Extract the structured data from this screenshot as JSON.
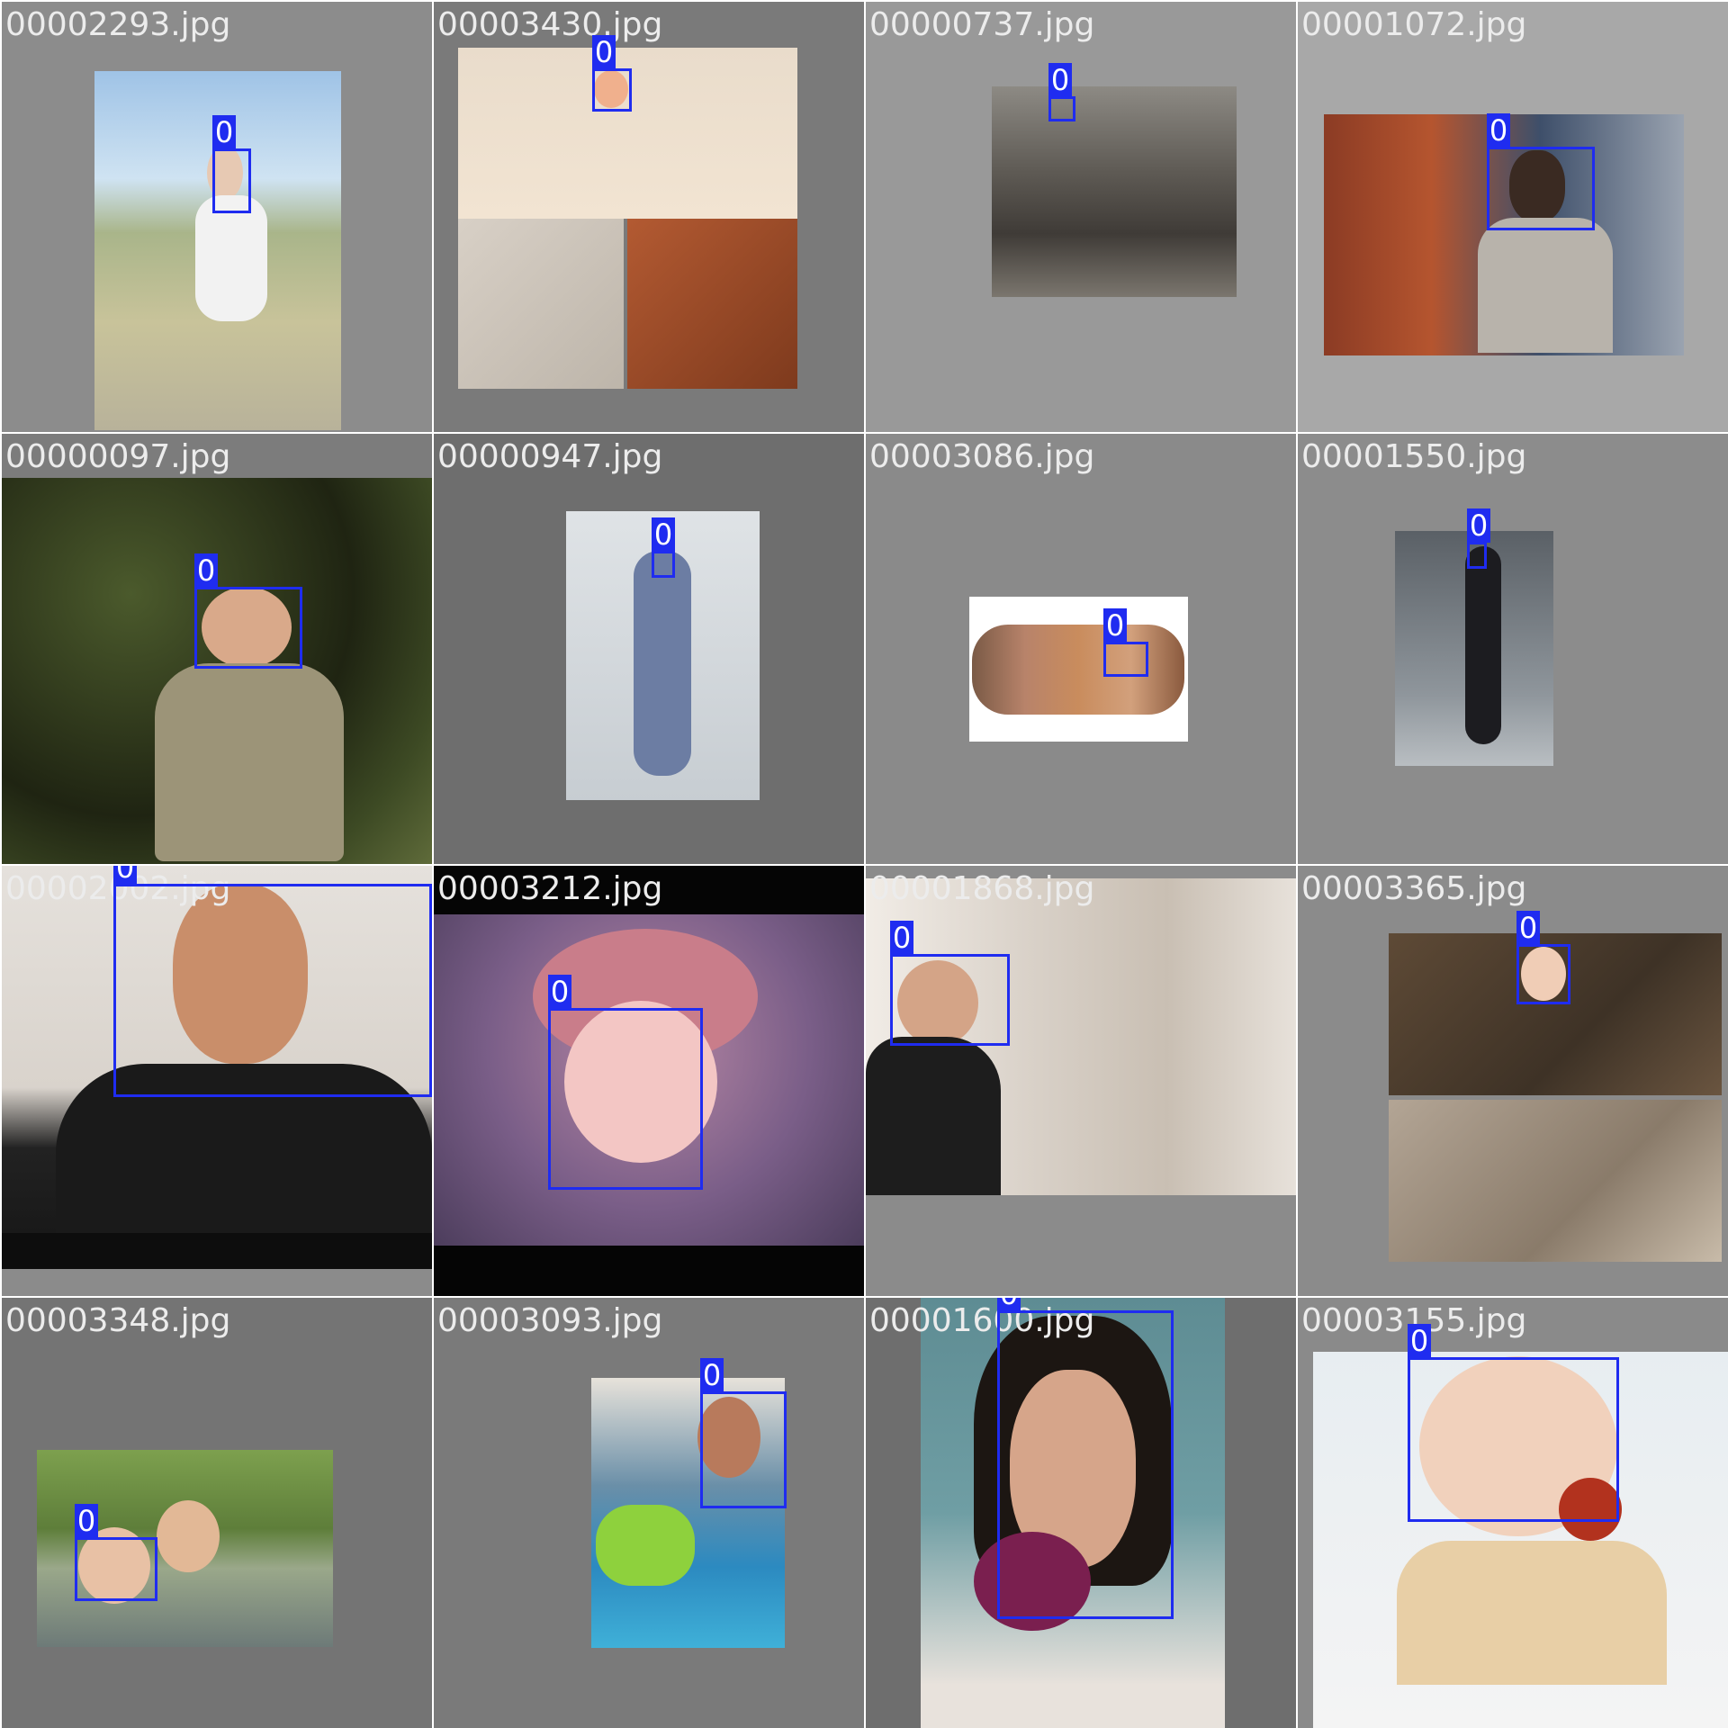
{
  "grid": {
    "tiles": [
      {
        "file": "00002293.jpg",
        "label": "0"
      },
      {
        "file": "00003430.jpg",
        "label": "0"
      },
      {
        "file": "00000737.jpg",
        "label": "0"
      },
      {
        "file": "00001072.jpg",
        "label": "0"
      },
      {
        "file": "00000097.jpg",
        "label": "0"
      },
      {
        "file": "00000947.jpg",
        "label": "0"
      },
      {
        "file": "00003086.jpg",
        "label": "0"
      },
      {
        "file": "00001550.jpg",
        "label": "0"
      },
      {
        "file": "00002002.jpg",
        "label": "0"
      },
      {
        "file": "00003212.jpg",
        "label": "0"
      },
      {
        "file": "00001868.jpg",
        "label": "0"
      },
      {
        "file": "00003365.jpg",
        "label": "0"
      },
      {
        "file": "00003348.jpg",
        "label": "0"
      },
      {
        "file": "00003093.jpg",
        "label": "0"
      },
      {
        "file": "00001600.jpg",
        "label": "0"
      },
      {
        "file": "00003155.jpg",
        "label": "0"
      }
    ]
  },
  "colors": {
    "box": "#1f2cf0",
    "label_text": "#ffffff",
    "filename_text": "#ececec"
  }
}
